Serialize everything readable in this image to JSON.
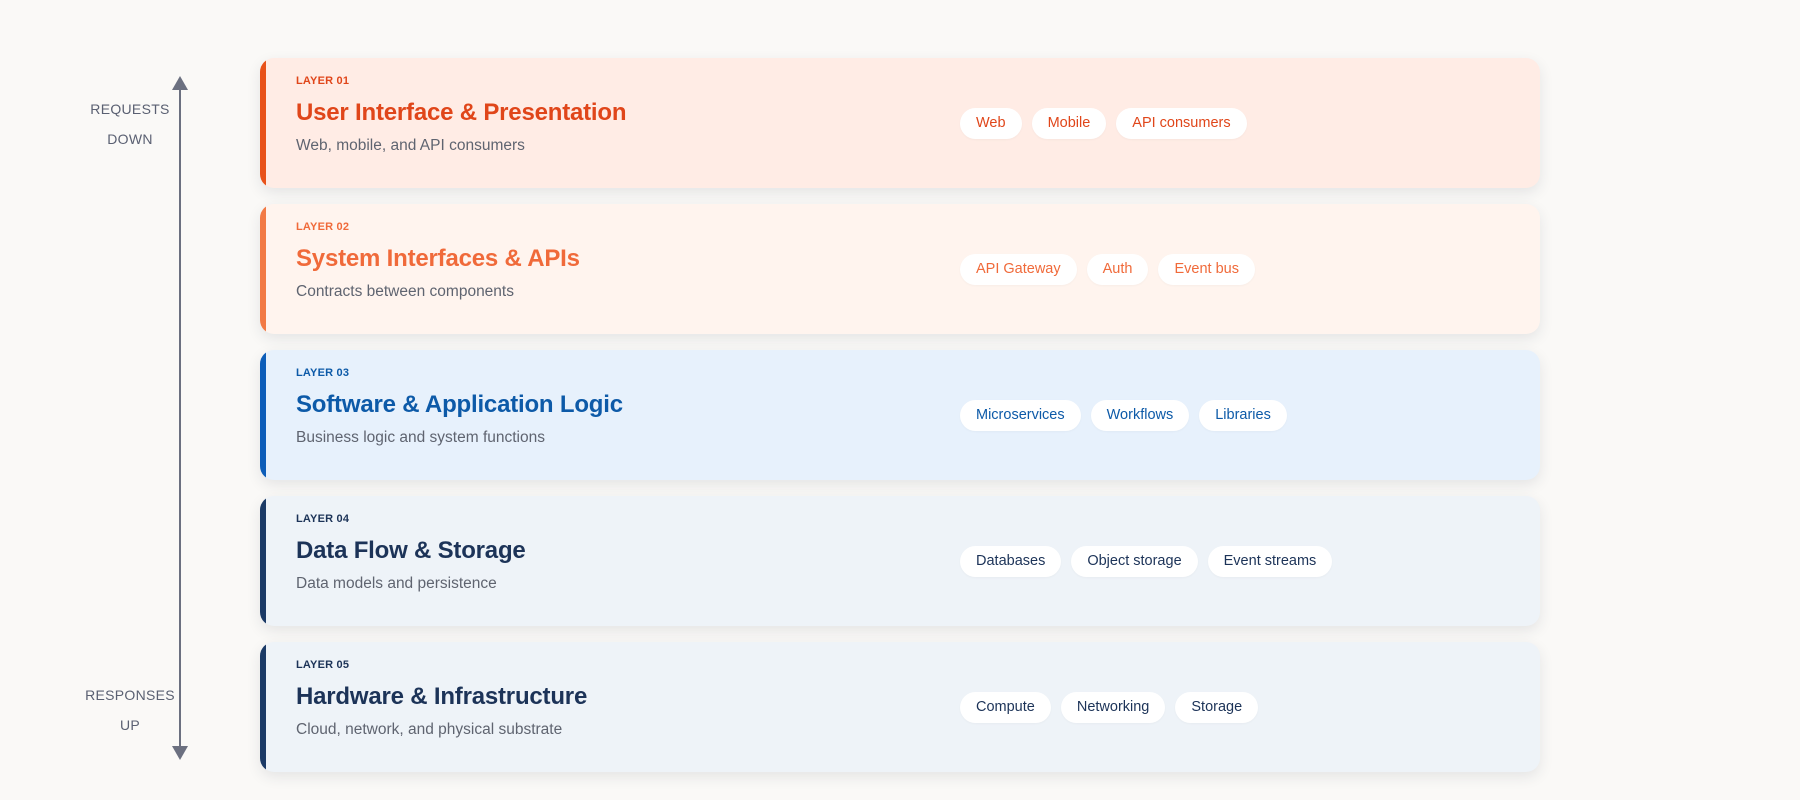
{
  "axis": {
    "top_label": [
      "REQUESTS",
      "DOWN"
    ],
    "bottom_label": [
      "RESPONSES",
      "UP"
    ],
    "color": "#6b7080"
  },
  "layers": [
    {
      "tag": "LAYER 01",
      "title": "User Interface & Presentation",
      "description": "Web, mobile, and API consumers",
      "chips": [
        "Web",
        "Mobile",
        "API consumers"
      ],
      "colors": {
        "accent": "#e8521a",
        "background": "#ffece5",
        "text": "#e0461a"
      }
    },
    {
      "tag": "LAYER 02",
      "title": "System Interfaces & APIs",
      "description": "Contracts between components",
      "chips": [
        "API Gateway",
        "Auth",
        "Event bus"
      ],
      "colors": {
        "accent": "#f27a45",
        "background": "#fff4ee",
        "text": "#f06a3a"
      }
    },
    {
      "tag": "LAYER 03",
      "title": "Software & Application Logic",
      "description": "Business logic and system functions",
      "chips": [
        "Microservices",
        "Workflows",
        "Libraries"
      ],
      "colors": {
        "accent": "#0d5db8",
        "background": "#e7f1fc",
        "text": "#0d5aa8"
      }
    },
    {
      "tag": "LAYER 04",
      "title": "Data Flow & Storage",
      "description": "Data models and persistence",
      "chips": [
        "Databases",
        "Object storage",
        "Event streams"
      ],
      "colors": {
        "accent": "#1b3a66",
        "background": "#eef3f8",
        "text": "#1c3358"
      }
    },
    {
      "tag": "LAYER 05",
      "title": "Hardware & Infrastructure",
      "description": "Cloud, network, and physical substrate",
      "chips": [
        "Compute",
        "Networking",
        "Storage"
      ],
      "colors": {
        "accent": "#1b3a66",
        "background": "#eef3f8",
        "text": "#1c3358"
      }
    }
  ]
}
